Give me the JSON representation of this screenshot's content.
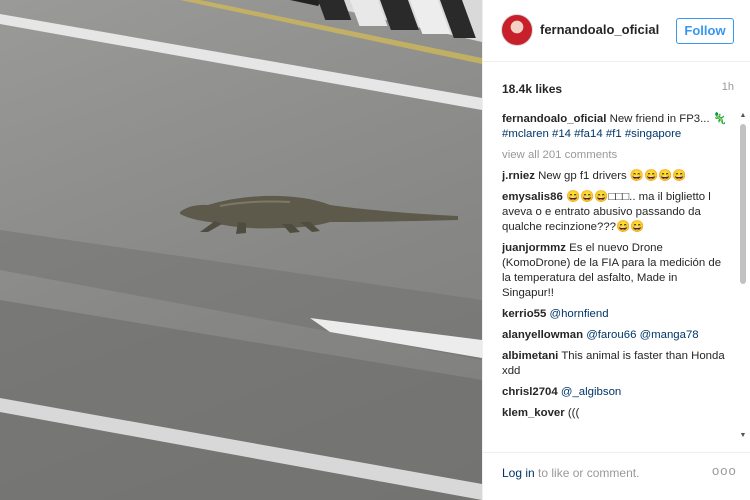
{
  "post": {
    "username": "fernandoalo_oficial",
    "follow_label": "Follow",
    "likes": "18.4k likes",
    "time": "1h",
    "caption_text": "New friend in FP3... 🦎",
    "caption_tags": "#mclaren #14 #fa14 #f1 #singapore",
    "view_all": "view all 201 comments"
  },
  "comments": [
    {
      "user": "j.rniez",
      "text": "New gp f1 drivers 😄😄😄😄"
    },
    {
      "user": "emysalis86",
      "text": "😄😄😄□□□.. ma il biglietto l aveva o e entrato abusivo passando da qualche recinzione???😄😄"
    },
    {
      "user": "juanjormmz",
      "text": "Es el nuevo Drone (KomoDrone) de la FIA para la medición de la temperatura del asfalto, Made in Singapur!!"
    },
    {
      "user": "kerrio55",
      "tag": "@hornfiend"
    },
    {
      "user": "alanyellowman",
      "tag": "@farou66 @manga78"
    },
    {
      "user": "albimetani",
      "text": "This animal is faster than Honda xdd"
    },
    {
      "user": "chrisl2704",
      "tag": "@_algibson"
    },
    {
      "user": "klem_kover",
      "text": "((("
    }
  ],
  "footer": {
    "login_link": "Log in",
    "login_rest": " to like or comment.",
    "more": "ooo"
  },
  "icons": {
    "avatar": "profile-avatar",
    "more": "more-options-icon",
    "scroll_up": "scroll-up-arrow",
    "scroll_down": "scroll-down-arrow"
  }
}
